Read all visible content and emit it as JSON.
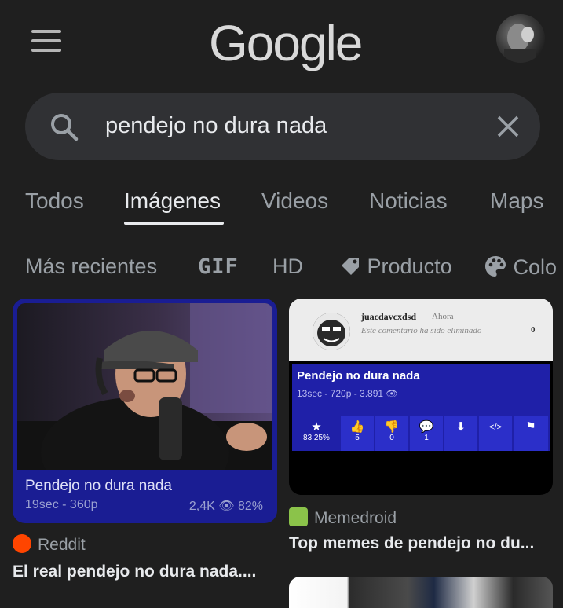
{
  "header": {
    "logo": "Google"
  },
  "search": {
    "query": "pendejo no dura nada"
  },
  "tabs": [
    {
      "label": "Todos"
    },
    {
      "label": "Imágenes"
    },
    {
      "label": "Videos"
    },
    {
      "label": "Noticias"
    },
    {
      "label": "Maps"
    }
  ],
  "filters": [
    {
      "label": "Más recientes"
    },
    {
      "label": "GIF"
    },
    {
      "label": "HD"
    },
    {
      "label": "Producto",
      "icon": "tag-icon"
    },
    {
      "label": "Colo",
      "icon": "palette-icon"
    }
  ],
  "results": [
    {
      "image_caption_title": "Pendejo no dura nada",
      "image_caption_meta": "19sec - 360p",
      "image_caption_stats": "2,4K 👁 82%",
      "source": "Reddit",
      "source_color": "#ff4500",
      "title": "El real pendejo no dura nada...."
    },
    {
      "image": {
        "username": "juacdavcxdsd",
        "time": "Ahora",
        "comment": "Este comentario ha sido eliminado",
        "count": "0",
        "panel_title": "Pendejo no dura nada",
        "panel_meta": "13sec - 720p - 3.891 👁",
        "rating": "83.25%",
        "buttons": [
          "5",
          "0",
          "1"
        ]
      },
      "source": "Memedroid",
      "title": "Top memes de pendejo no du..."
    }
  ],
  "colors": {
    "background": "#1f1f1f",
    "search_bg": "#303134",
    "text_primary": "#e8eaed",
    "text_secondary": "#9aa0a6"
  }
}
